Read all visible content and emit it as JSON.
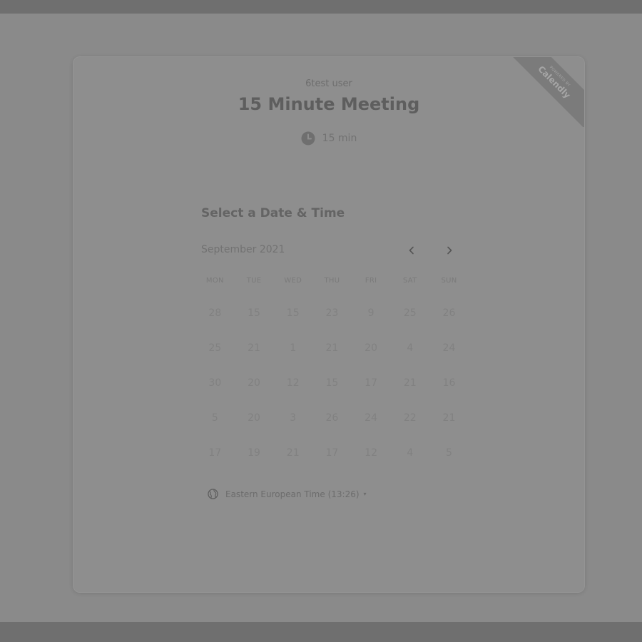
{
  "header": {
    "host_name": "6test user",
    "event_title": "15 Minute Meeting",
    "duration": "15 min",
    "duration_icon": "clock-icon"
  },
  "ribbon": {
    "small_text": "POWERED BY",
    "brand": "Calendly"
  },
  "calendar": {
    "section_title": "Select a Date & Time",
    "month": "September 2021",
    "prev_icon": "chevron-left-icon",
    "next_icon": "chevron-right-icon",
    "weekdays": [
      "MON",
      "TUE",
      "WED",
      "THU",
      "FRI",
      "SAT",
      "SUN"
    ],
    "weeks": [
      [
        "28",
        "15",
        "15",
        "23",
        "9",
        "25",
        "26"
      ],
      [
        "25",
        "21",
        "1",
        "21",
        "20",
        "4",
        "24"
      ],
      [
        "30",
        "20",
        "12",
        "15",
        "17",
        "21",
        "16"
      ],
      [
        "5",
        "20",
        "3",
        "26",
        "24",
        "22",
        "21"
      ],
      [
        "17",
        "19",
        "21",
        "17",
        "12",
        "4",
        "5"
      ]
    ]
  },
  "timezone": {
    "label": "Eastern European Time (13:26)",
    "icon": "globe-icon",
    "caret": "▾"
  },
  "colors": {
    "overlay": "#8a8a8a",
    "bars": "#6f6f6f",
    "card": "#8e8e8e",
    "ribbon": "#7b7b7b"
  }
}
